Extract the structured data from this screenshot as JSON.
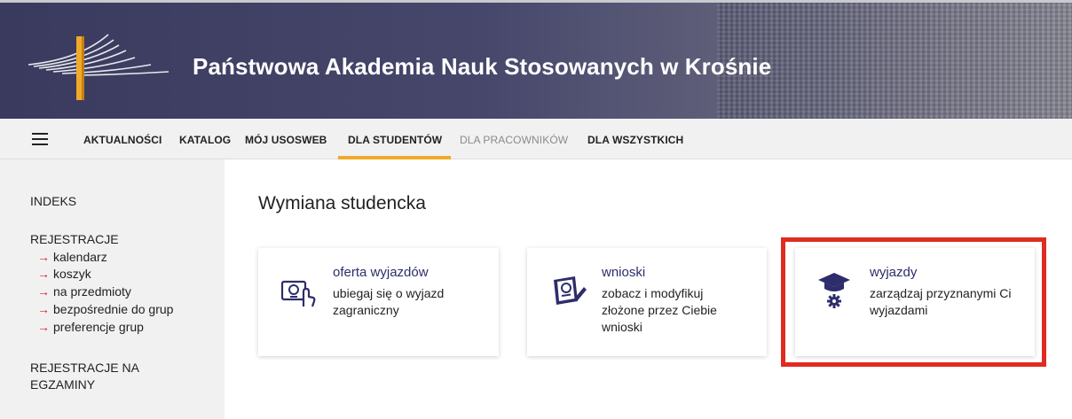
{
  "header": {
    "title": "Państwowa Akademia Nauk Stosowanych w Krośnie"
  },
  "nav": {
    "items": [
      {
        "label": "AKTUALNOŚCI"
      },
      {
        "label": "KATALOG"
      },
      {
        "label": "MÓJ USOSWEB"
      },
      {
        "label": "DLA STUDENTÓW",
        "active": true
      },
      {
        "label": "DLA PRACOWNIKÓW",
        "muted": true
      },
      {
        "label": "DLA WSZYSTKICH"
      }
    ],
    "accent_color": "#f0a92a"
  },
  "sidebar": {
    "indeks": "INDEKS",
    "rejestracje": "REJESTRACJE",
    "rejestracje_items": [
      {
        "arrow": "→",
        "label": "kalendarz"
      },
      {
        "arrow": "→",
        "label": "koszyk"
      },
      {
        "arrow": "→",
        "label": "na przedmioty"
      },
      {
        "arrow": "→",
        "label": "bezpośrednie do grup"
      },
      {
        "arrow": "→",
        "label": "preferencje grup"
      }
    ],
    "rejestracje_egzaminy_line1": "REJESTRACJE NA",
    "rejestracje_egzaminy_line2": "EGZAMINY"
  },
  "main": {
    "title": "Wymiana studencka",
    "cards": [
      {
        "title": "oferta wyjazdów",
        "desc_lines": [
          "ubiegaj się o wyjazd",
          "zagraniczny"
        ],
        "icon": "certificate-touch-icon"
      },
      {
        "title": "wnioski",
        "desc_lines": [
          "zobacz i modyfikuj",
          "złożone przez Ciebie",
          "wnioski"
        ],
        "icon": "document-pen-icon"
      },
      {
        "title": "wyjazdy",
        "desc_lines": [
          "zarządzaj przyznanymi Ci",
          "wyjazdami"
        ],
        "icon": "graduation-cap-gear-icon"
      }
    ]
  },
  "colors": {
    "highlight": "#e02b20",
    "card_title": "#2d2d6b",
    "arrow": "#d0262a"
  }
}
